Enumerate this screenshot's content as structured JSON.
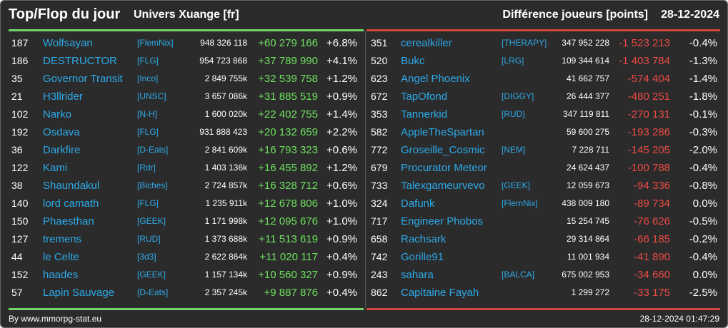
{
  "header": {
    "title": "Top/Flop du jour",
    "subtitle": "Univers Xuange [fr]",
    "metric": "Différence joueurs [points]",
    "date": "28-12-2024"
  },
  "colors": {
    "background": "#2b2b2b",
    "top_accent": "#72d46a",
    "flop_accent": "#d4463f",
    "name_link": "#2da9e8",
    "positive_diff": "#6ee05f",
    "negative_diff": "#ea4a45"
  },
  "top": [
    {
      "rank": "187",
      "name": "Wolfsayan",
      "alliance": "[FlemNix]",
      "score": "948 326 118",
      "diff": "+60 279 166",
      "pct": "+6.8%"
    },
    {
      "rank": "186",
      "name": "DESTRUCTOR",
      "alliance": "[FLG]",
      "score": "954 723 868",
      "diff": "+37 789 990",
      "pct": "+4.1%"
    },
    {
      "rank": "35",
      "name": "Governor Transit",
      "alliance": "[Inco]",
      "score": "2 849 755k",
      "diff": "+32 539 758",
      "pct": "+1.2%"
    },
    {
      "rank": "21",
      "name": "H3llrider",
      "alliance": "[UNSC]",
      "score": "3 657 086k",
      "diff": "+31 885 519",
      "pct": "+0.9%"
    },
    {
      "rank": "102",
      "name": "Narko",
      "alliance": "[N-H]",
      "score": "1 600 020k",
      "diff": "+22 402 755",
      "pct": "+1.4%"
    },
    {
      "rank": "192",
      "name": "Osdava",
      "alliance": "[FLG]",
      "score": "931 888 423",
      "diff": "+20 132 659",
      "pct": "+2.2%"
    },
    {
      "rank": "36",
      "name": "Darkfire",
      "alliance": "[D-Eats]",
      "score": "2 841 609k",
      "diff": "+16 793 323",
      "pct": "+0.6%"
    },
    {
      "rank": "122",
      "name": "Kami",
      "alliance": "[Rdr]",
      "score": "1 403 136k",
      "diff": "+16 455 892",
      "pct": "+1.2%"
    },
    {
      "rank": "38",
      "name": "Shaundakul",
      "alliance": "[Biches]",
      "score": "2 724 857k",
      "diff": "+16 328 712",
      "pct": "+0.6%"
    },
    {
      "rank": "140",
      "name": "lord camath",
      "alliance": "[FLG]",
      "score": "1 235 911k",
      "diff": "+12 678 806",
      "pct": "+1.0%"
    },
    {
      "rank": "150",
      "name": "Phaesthan",
      "alliance": "[GEEK]",
      "score": "1 171 998k",
      "diff": "+12 095 676",
      "pct": "+1.0%"
    },
    {
      "rank": "127",
      "name": "tremens",
      "alliance": "[RUD]",
      "score": "1 373 688k",
      "diff": "+11 513 619",
      "pct": "+0.9%"
    },
    {
      "rank": "44",
      "name": "le Celte",
      "alliance": "[3d3]",
      "score": "2 622 864k",
      "diff": "+11 020 117",
      "pct": "+0.4%"
    },
    {
      "rank": "152",
      "name": "haades",
      "alliance": "[GEEK]",
      "score": "1 157 134k",
      "diff": "+10 560 327",
      "pct": "+0.9%"
    },
    {
      "rank": "57",
      "name": "Lapin Sauvage",
      "alliance": "[D-Eats]",
      "score": "2 357 245k",
      "diff": "+9 887 876",
      "pct": "+0.4%"
    }
  ],
  "flop": [
    {
      "rank": "351",
      "name": "cerealkiller",
      "alliance": "[THERAPY]",
      "score": "347 952 228",
      "diff": "-1 523 213",
      "pct": "-0.4%"
    },
    {
      "rank": "520",
      "name": "Bukc",
      "alliance": "[LRG]",
      "score": "109 344 614",
      "diff": "-1 403 784",
      "pct": "-1.3%"
    },
    {
      "rank": "623",
      "name": "Angel Phoenix",
      "alliance": "",
      "score": "41 662 757",
      "diff": "-574 404",
      "pct": "-1.4%"
    },
    {
      "rank": "672",
      "name": "TapOfond",
      "alliance": "[DIGGY]",
      "score": "26 444 377",
      "diff": "-480 251",
      "pct": "-1.8%"
    },
    {
      "rank": "353",
      "name": "Tannerkid",
      "alliance": "[RUD]",
      "score": "347 119 811",
      "diff": "-270 131",
      "pct": "-0.1%"
    },
    {
      "rank": "582",
      "name": "AppleTheSpartan",
      "alliance": "",
      "score": "59 600 275",
      "diff": "-193 286",
      "pct": "-0.3%"
    },
    {
      "rank": "772",
      "name": "Groseille_Cosmic",
      "alliance": "[NEM]",
      "score": "7 228 711",
      "diff": "-145 205",
      "pct": "-2.0%"
    },
    {
      "rank": "679",
      "name": "Procurator Meteor",
      "alliance": "",
      "score": "24 624 437",
      "diff": "-100 788",
      "pct": "-0.4%"
    },
    {
      "rank": "733",
      "name": "Talexgameurvevo",
      "alliance": "[GEEK]",
      "score": "12 059 673",
      "diff": "-94 336",
      "pct": "-0.8%"
    },
    {
      "rank": "324",
      "name": "Dafunk",
      "alliance": "[FlemNix]",
      "score": "438 009 180",
      "diff": "-89 734",
      "pct": "0.0%"
    },
    {
      "rank": "717",
      "name": "Engineer Phobos",
      "alliance": "",
      "score": "15 254 745",
      "diff": "-76 626",
      "pct": "-0.5%"
    },
    {
      "rank": "658",
      "name": "Rachsark",
      "alliance": "",
      "score": "29 314 864",
      "diff": "-66 185",
      "pct": "-0.2%"
    },
    {
      "rank": "742",
      "name": "Gorille91",
      "alliance": "",
      "score": "11 001 934",
      "diff": "-41 890",
      "pct": "-0.4%"
    },
    {
      "rank": "243",
      "name": "sahara",
      "alliance": "[BALCA]",
      "score": "675 002 953",
      "diff": "-34 660",
      "pct": "0.0%"
    },
    {
      "rank": "862",
      "name": "Capitaine Fayah",
      "alliance": "",
      "score": "1 299 272",
      "diff": "-33 175",
      "pct": "-2.5%"
    }
  ],
  "footer": {
    "source": "By www.mmorpg-stat.eu",
    "timestamp": "28-12-2024 01:47:29"
  }
}
